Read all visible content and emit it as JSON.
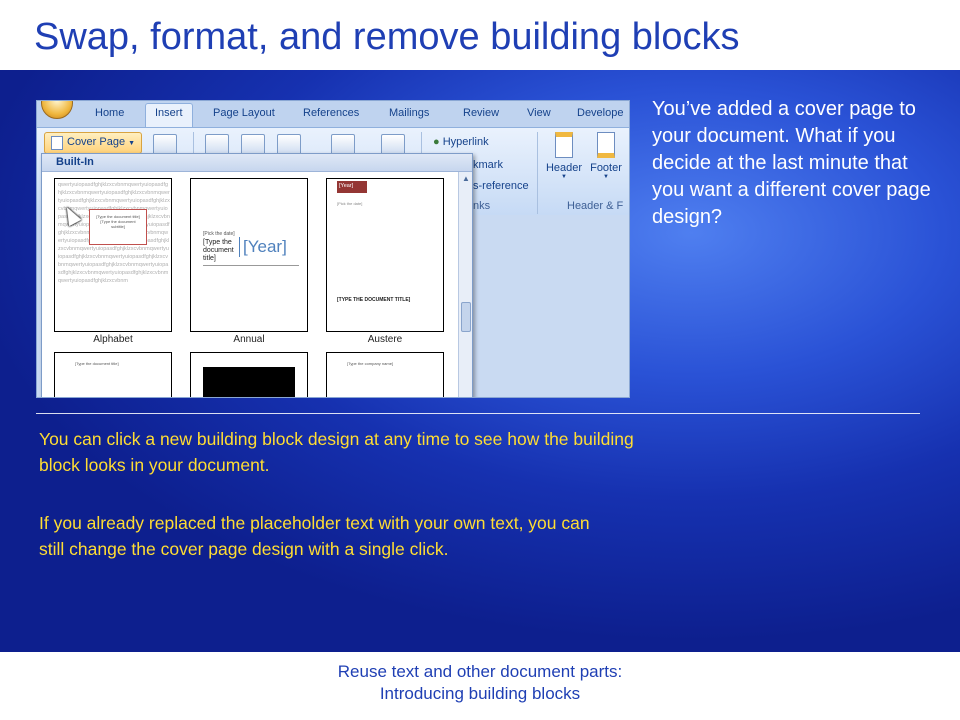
{
  "slide": {
    "title": "Swap, format, and remove building blocks",
    "right_text": "You’ve added a cover page to your document. What if you decide at the last minute that you want a different cover page design?",
    "note1": "You can click a new building block design at any time to see how the building block looks in your document.",
    "note2": "If you already replaced the placeholder text with your own text, you can still change the cover page design with a single click.",
    "footer_line1": "Reuse text and other document parts:",
    "footer_line2": "Introducing building blocks"
  },
  "word": {
    "tabs": [
      "Home",
      "Insert",
      "Page Layout",
      "References",
      "Mailings",
      "Review",
      "View",
      "Develope"
    ],
    "active_tab": "Insert",
    "cover_page_button": "Cover Page",
    "hyperlink": "Hyperlink",
    "bookmark_partial": "kmark",
    "crossref_partial": "s-reference",
    "links_partial": "nks",
    "header_button": "Header",
    "footer_button": "Footer",
    "header_footer_group": "Header & F",
    "gallery": {
      "header": "Built-In",
      "items": [
        {
          "label": "Alphabet",
          "box_text": "[Type the document title]",
          "box_sub": "[Type the document subtitle]"
        },
        {
          "label": "Annual",
          "small": "[Pick the date]",
          "doc_title": "[Type the document title]",
          "year": "[Year]"
        },
        {
          "label": "Austere",
          "year": "[Year]",
          "small": "[Pick the date]",
          "doc_title": "[TYPE THE DOCUMENT TITLE]"
        }
      ],
      "row2_text1": "[Type the document title]",
      "row2_text3": "[Type the company name]",
      "alphabet_filler": "qwertyuiopasdfghjklzxcvbnmqwertyuiopasdfghjklzxcvbnmqwertyuiopasdfghjklzxcvbnmqwertyuiopasdfghjklzxcvbnmqwertyuiopasdfghjklzxcvbnmqwertyuiopasdfghjklzxcvbnmqwertyuiopasdfghjklzxcvbnmqwertyuiopasdfghjklzxcvbnmqwertyuiopasdfghjklzxcvbnmqwertyuiopasdfghjklzxcvbnmqwertyuiopasdfghjklzxcvbnmqwertyuiopasdfghjklzxcvbnmqwertyuiopasdfghjklzxcvbnmqwertyuiopasdfghjklzxcvbnmqwertyuiopasdfghjklzxcvbnmqwertyuiopasdfghjklzxcvbnmqwertyuiopasdfghjklzxcvbnmqwertyuiopasdfghjklzxcvbnmqwertyuiopasdfghjklzxcvbnmqwertyuiopasdfghjklzxcvbnm"
    }
  },
  "colors": {
    "title": "#1f3fb4",
    "note": "#ffdd33",
    "body_bg": "#2a52d6"
  }
}
